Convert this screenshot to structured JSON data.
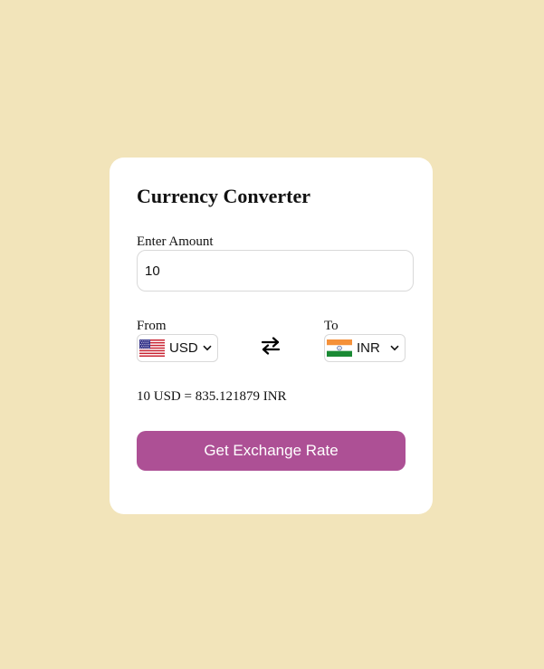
{
  "converter": {
    "title": "Currency Converter",
    "amount_label": "Enter Amount",
    "amount_value": "10",
    "from_label": "From",
    "to_label": "To",
    "from_currency": {
      "code": "USD",
      "flag": "us-flag-icon"
    },
    "to_currency": {
      "code": "INR",
      "flag": "in-flag-icon"
    },
    "swap_icon": "swap-arrows-icon",
    "result_text": "10 USD = 835.121879 INR",
    "button_label": "Get Exchange Rate"
  },
  "colors": {
    "page_background": "#f2e4ba",
    "card_background": "#ffffff",
    "button_background": "#ad5095",
    "button_text": "#ffffff"
  }
}
